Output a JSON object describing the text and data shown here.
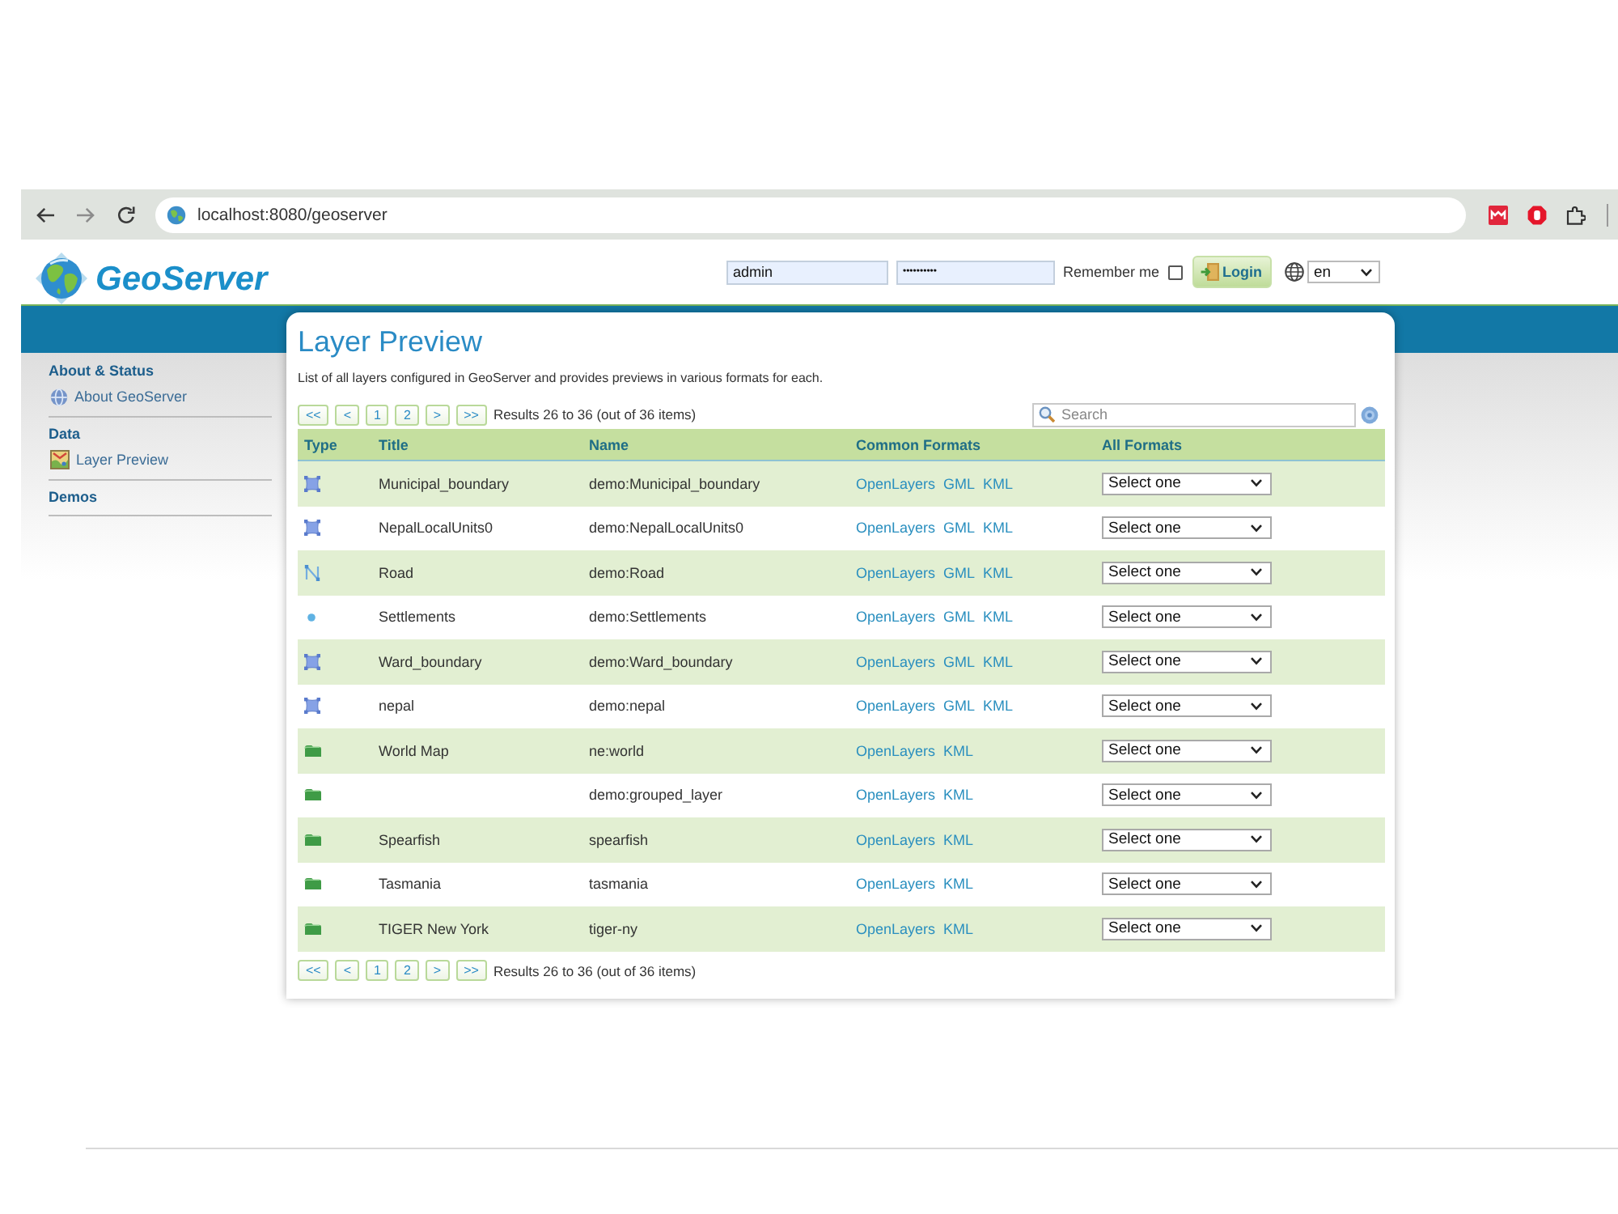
{
  "browser": {
    "url": "localhost:8080/geoserver"
  },
  "header": {
    "logo": "GeoServer",
    "username": "admin",
    "password": "••••••••••",
    "remember_me": {
      "label": "Remember me",
      "checked": false
    },
    "login_button": "Login",
    "language": "en"
  },
  "sidebar": [
    {
      "title": "About & Status",
      "items": [
        {
          "label": "About GeoServer",
          "kind": "about"
        }
      ]
    },
    {
      "title": "Data",
      "items": [
        {
          "label": "Layer Preview",
          "kind": "preview"
        }
      ]
    },
    {
      "title": "Demos"
    }
  ],
  "page": {
    "title": "Layer Preview",
    "description": "List of all layers configured in GeoServer and provides previews in various formats for each.",
    "pager": {
      "buttons": [
        "<<",
        "<",
        "1",
        "2",
        ">",
        ">>"
      ],
      "results": "Results 26 to 36 (out of 36 items)"
    },
    "search": {
      "placeholder": "Search"
    }
  },
  "table": {
    "columns": [
      "Type",
      "Title",
      "Name",
      "Common Formats",
      "All Formats"
    ],
    "rows": [
      {
        "kind": "polygon",
        "title": "Municipal_boundary",
        "name": "demo:Municipal_boundary",
        "formats": [
          "OpenLayers",
          "GML",
          "KML"
        ],
        "all_formats": "Select one"
      },
      {
        "kind": "polygon",
        "title": "NepalLocalUnits0",
        "name": "demo:NepalLocalUnits0",
        "formats": [
          "OpenLayers",
          "GML",
          "KML"
        ],
        "all_formats": "Select one"
      },
      {
        "kind": "line",
        "title": "Road",
        "name": "demo:Road",
        "formats": [
          "OpenLayers",
          "GML",
          "KML"
        ],
        "all_formats": "Select one"
      },
      {
        "kind": "point",
        "title": "Settlements",
        "name": "demo:Settlements",
        "formats": [
          "OpenLayers",
          "GML",
          "KML"
        ],
        "all_formats": "Select one"
      },
      {
        "kind": "polygon",
        "title": "Ward_boundary",
        "name": "demo:Ward_boundary",
        "formats": [
          "OpenLayers",
          "GML",
          "KML"
        ],
        "all_formats": "Select one"
      },
      {
        "kind": "polygon",
        "title": "nepal",
        "name": "demo:nepal",
        "formats": [
          "OpenLayers",
          "GML",
          "KML"
        ],
        "all_formats": "Select one"
      },
      {
        "kind": "group",
        "title": "World Map",
        "name": "ne:world",
        "formats": [
          "OpenLayers",
          "KML"
        ],
        "all_formats": "Select one"
      },
      {
        "kind": "group",
        "name": "demo:grouped_layer",
        "formats": [
          "OpenLayers",
          "KML"
        ],
        "all_formats": "Select one"
      },
      {
        "kind": "group",
        "title": "Spearfish",
        "name": "spearfish",
        "formats": [
          "OpenLayers",
          "KML"
        ],
        "all_formats": "Select one"
      },
      {
        "kind": "group",
        "title": "Tasmania",
        "name": "tasmania",
        "formats": [
          "OpenLayers",
          "KML"
        ],
        "all_formats": "Select one"
      },
      {
        "kind": "group",
        "title": "TIGER New York",
        "name": "tiger-ny",
        "formats": [
          "OpenLayers",
          "KML"
        ],
        "all_formats": "Select one"
      }
    ]
  },
  "bottom_pager": {
    "buttons": [
      "<<",
      "<",
      "1",
      "2",
      ">",
      ">>"
    ],
    "results": "Results 26 to 36 (out of 36 items)"
  }
}
